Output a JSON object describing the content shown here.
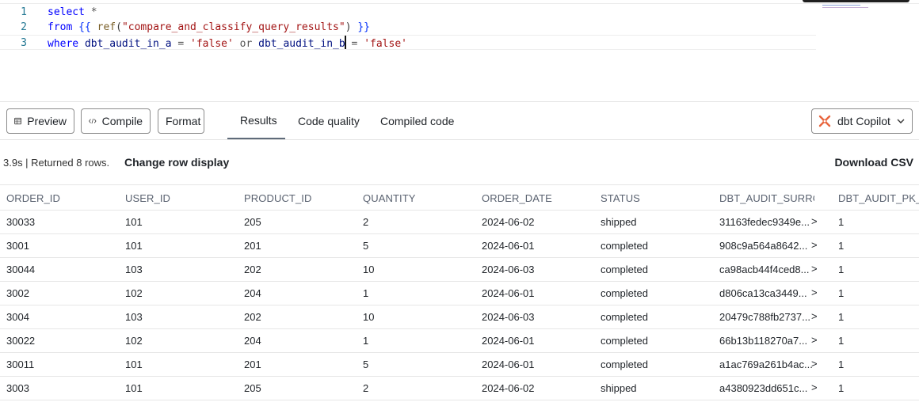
{
  "editor": {
    "lines": [
      {
        "num": "1",
        "tokens": [
          {
            "t": "select",
            "c": "kw"
          },
          {
            "t": " ",
            "c": "plain"
          },
          {
            "t": "*",
            "c": "op"
          }
        ]
      },
      {
        "num": "2",
        "tokens": [
          {
            "t": "from",
            "c": "kw"
          },
          {
            "t": " ",
            "c": "plain"
          },
          {
            "t": "{{",
            "c": "br"
          },
          {
            "t": " ",
            "c": "plain"
          },
          {
            "t": "ref",
            "c": "fn"
          },
          {
            "t": "(",
            "c": "plain"
          },
          {
            "t": "\"compare_and_classify_query_results\"",
            "c": "str"
          },
          {
            "t": ")",
            "c": "plain"
          },
          {
            "t": " ",
            "c": "plain"
          },
          {
            "t": "}}",
            "c": "br"
          }
        ]
      },
      {
        "num": "3",
        "tokens": [
          {
            "t": "where",
            "c": "kw"
          },
          {
            "t": " dbt_audit_in_a ",
            "c": "id"
          },
          {
            "t": "=",
            "c": "op"
          },
          {
            "t": " ",
            "c": "plain"
          },
          {
            "t": "'false'",
            "c": "str"
          },
          {
            "t": " ",
            "c": "plain"
          },
          {
            "t": "or",
            "c": "op"
          },
          {
            "t": " dbt_audit_in_b",
            "c": "id"
          },
          {
            "t": "|",
            "c": "cursor"
          },
          {
            "t": " ",
            "c": "plain"
          },
          {
            "t": "=",
            "c": "op"
          },
          {
            "t": " ",
            "c": "plain"
          },
          {
            "t": "'false'",
            "c": "str"
          }
        ]
      }
    ]
  },
  "toolbar": {
    "preview_label": "Preview",
    "compile_label": "Compile",
    "format_label": "Format",
    "tabs": [
      "Results",
      "Code quality",
      "Compiled code"
    ],
    "active_tab": "Results",
    "copilot_label": "dbt Copilot",
    "copilot_color": "#e8643c"
  },
  "status": {
    "run_info": "3.9s | Returned 8 rows.",
    "change_row_display": "Change row display",
    "download_csv": "Download CSV"
  },
  "results": {
    "columns": [
      "ORDER_ID",
      "USER_ID",
      "PRODUCT_ID",
      "QUANTITY",
      "ORDER_DATE",
      "STATUS",
      "DBT_AUDIT_SURROGATE_KEY",
      "DBT_AUDIT_PK_ROW_NUM"
    ],
    "rows": [
      [
        "30033",
        "101",
        "205",
        "2",
        "2024-06-02",
        "shipped",
        "31163fedec9349e...",
        "1"
      ],
      [
        "3001",
        "101",
        "201",
        "5",
        "2024-06-01",
        "completed",
        "908c9a564a8642...",
        "1"
      ],
      [
        "30044",
        "103",
        "202",
        "10",
        "2024-06-03",
        "completed",
        "ca98acb44f4ced8...",
        "1"
      ],
      [
        "3002",
        "102",
        "204",
        "1",
        "2024-06-01",
        "completed",
        "d806ca13ca3449...",
        "1"
      ],
      [
        "3004",
        "103",
        "202",
        "10",
        "2024-06-03",
        "completed",
        "20479c788fb2737...",
        "1"
      ],
      [
        "30022",
        "102",
        "204",
        "1",
        "2024-06-01",
        "completed",
        "66b13b118270a7...",
        "1"
      ],
      [
        "30011",
        "101",
        "201",
        "5",
        "2024-06-01",
        "completed",
        "a1ac769a261b4ac...",
        "1"
      ],
      [
        "3003",
        "101",
        "205",
        "2",
        "2024-06-02",
        "shipped",
        "a4380923dd651c...",
        "1"
      ]
    ],
    "expand_glyph": ">"
  }
}
